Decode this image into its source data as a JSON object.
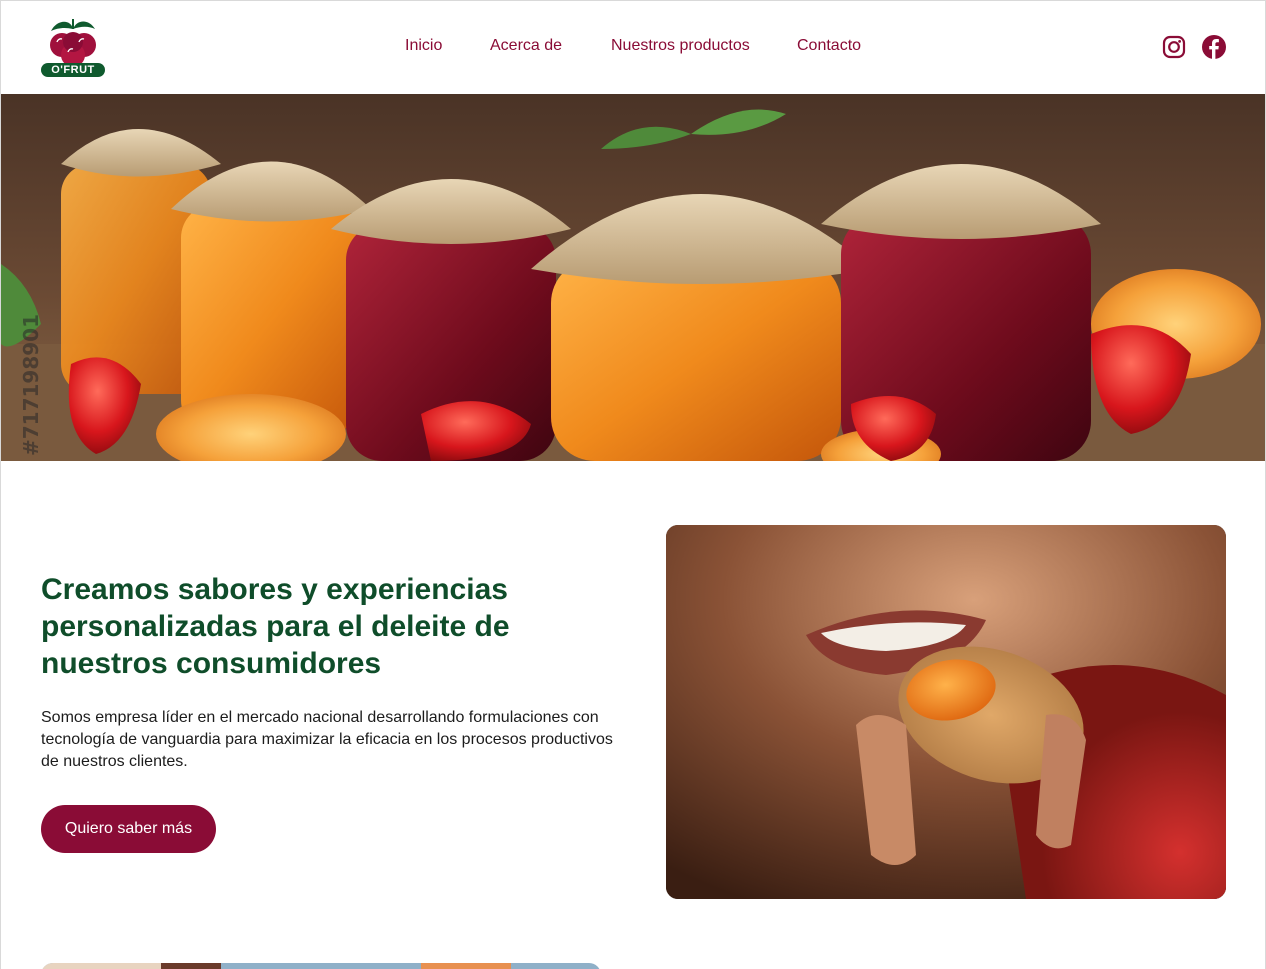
{
  "brand": {
    "name": "O'FRUT"
  },
  "nav": {
    "items": [
      "Inicio",
      "Acerca de",
      "Nuestros productos",
      "Contacto"
    ]
  },
  "social": {
    "instagram": "instagram-icon",
    "facebook": "facebook-icon"
  },
  "hero": {
    "stock_id": "#717198901"
  },
  "intro": {
    "title": "Creamos sabores y experiencias personalizadas para el deleite de nuestros consumidores",
    "text": "Somos empresa líder en el mercado nacional desarrollando formulaciones con tecnología de vanguardia para maximizar la eficacia en los procesos productivos de nuestros clientes.",
    "cta_label": "Quiero saber más"
  },
  "colors": {
    "accent": "#8a0c36",
    "heading": "#0f4d2a"
  }
}
